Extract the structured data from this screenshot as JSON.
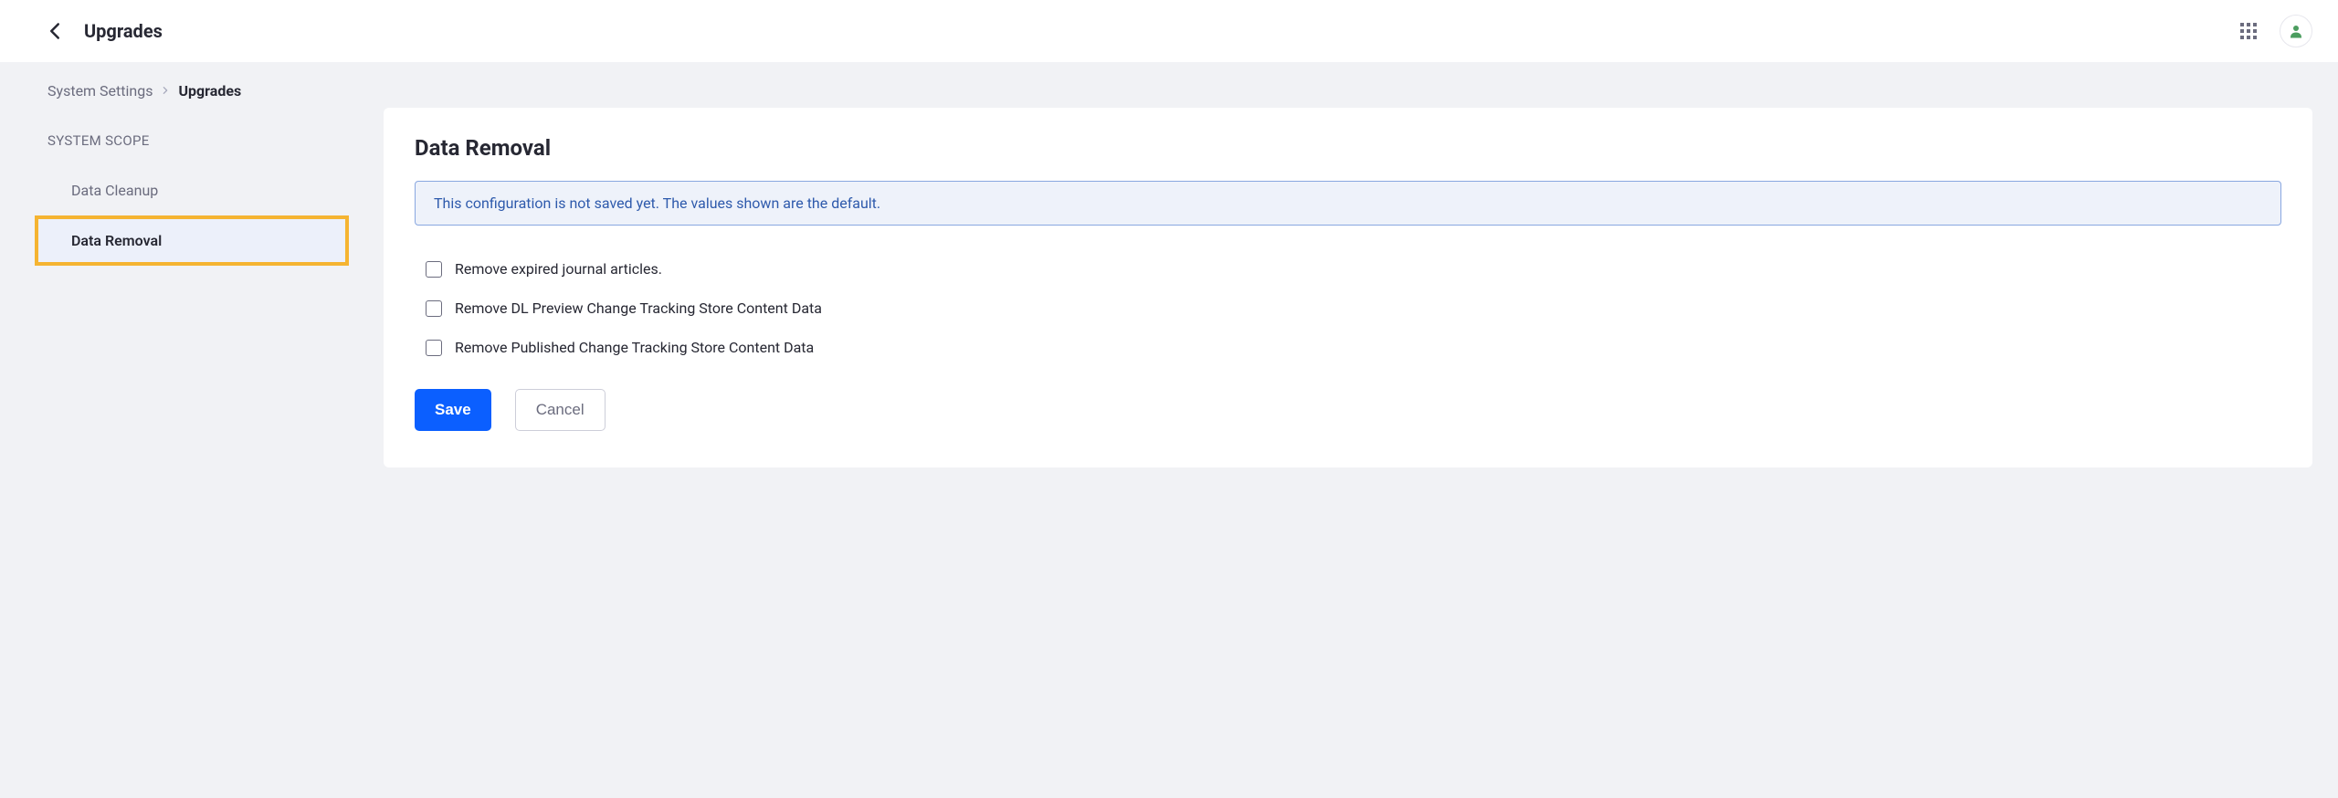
{
  "header": {
    "title": "Upgrades"
  },
  "breadcrumb": {
    "parent": "System Settings",
    "current": "Upgrades"
  },
  "sidebar": {
    "scope_header": "SYSTEM SCOPE",
    "items": [
      {
        "label": "Data Cleanup",
        "active": false
      },
      {
        "label": "Data Removal",
        "active": true
      }
    ]
  },
  "panel": {
    "title": "Data Removal",
    "info_message": "This configuration is not saved yet. The values shown are the default.",
    "options": [
      {
        "label": "Remove expired journal articles.",
        "checked": false
      },
      {
        "label": "Remove DL Preview Change Tracking Store Content Data",
        "checked": false
      },
      {
        "label": "Remove Published Change Tracking Store Content Data",
        "checked": false
      }
    ],
    "save_label": "Save",
    "cancel_label": "Cancel"
  }
}
